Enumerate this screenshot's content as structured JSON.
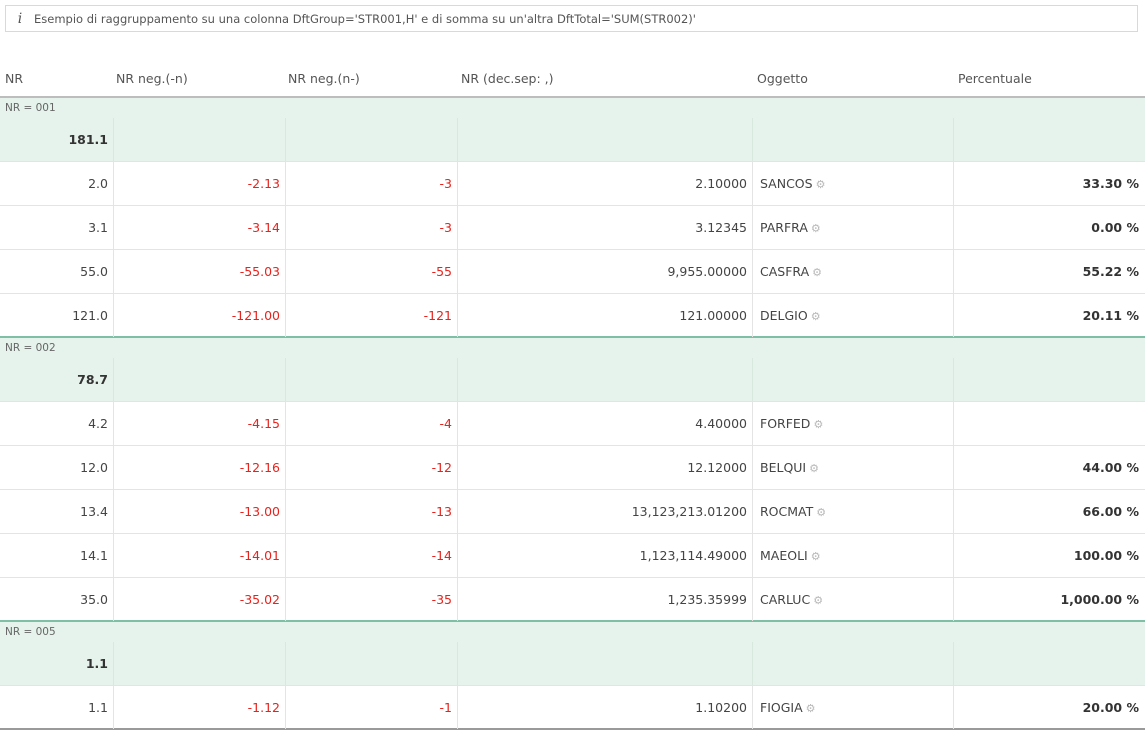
{
  "info": {
    "icon": "info-icon",
    "text": "Esempio di raggruppamento su una colonna DftGroup='STR001,H' e di somma su un'altra DftTotal='SUM(STR002)'"
  },
  "columns": [
    "NR",
    "NR neg.(-n)",
    "NR neg.(n-)",
    "NR (dec.sep: ,)",
    "Oggetto",
    "Percentuale"
  ],
  "groups": [
    {
      "label": "NR = 001",
      "total": "181.1",
      "rows": [
        {
          "nr": "2.0",
          "neg1": "-2.13",
          "neg2": "-3",
          "dec": "2.10000",
          "obj": "SANCOS",
          "perc": "33.30 %"
        },
        {
          "nr": "3.1",
          "neg1": "-3.14",
          "neg2": "-3",
          "dec": "3.12345",
          "obj": "PARFRA",
          "perc": "0.00 %"
        },
        {
          "nr": "55.0",
          "neg1": "-55.03",
          "neg2": "-55",
          "dec": "9,955.00000",
          "obj": "CASFRA",
          "perc": "55.22 %"
        },
        {
          "nr": "121.0",
          "neg1": "-121.00",
          "neg2": "-121",
          "dec": "121.00000",
          "obj": "DELGIO",
          "perc": "20.11 %"
        }
      ]
    },
    {
      "label": "NR = 002",
      "total": "78.7",
      "rows": [
        {
          "nr": "4.2",
          "neg1": "-4.15",
          "neg2": "-4",
          "dec": "4.40000",
          "obj": "FORFED",
          "perc": ""
        },
        {
          "nr": "12.0",
          "neg1": "-12.16",
          "neg2": "-12",
          "dec": "12.12000",
          "obj": "BELQUI",
          "perc": "44.00 %"
        },
        {
          "nr": "13.4",
          "neg1": "-13.00",
          "neg2": "-13",
          "dec": "13,123,213.01200",
          "obj": "ROCMAT",
          "perc": "66.00 %"
        },
        {
          "nr": "14.1",
          "neg1": "-14.01",
          "neg2": "-14",
          "dec": "1,123,114.49000",
          "obj": "MAEOLI",
          "perc": "100.00 %"
        },
        {
          "nr": "35.0",
          "neg1": "-35.02",
          "neg2": "-35",
          "dec": "1,235.35999",
          "obj": "CARLUC",
          "perc": "1,000.00 %"
        }
      ]
    },
    {
      "label": "NR = 005",
      "total": "1.1",
      "rows": [
        {
          "nr": "1.1",
          "neg1": "-1.12",
          "neg2": "-1",
          "dec": "1.10200",
          "obj": "FIOGIA",
          "perc": "20.00 %"
        }
      ]
    }
  ]
}
